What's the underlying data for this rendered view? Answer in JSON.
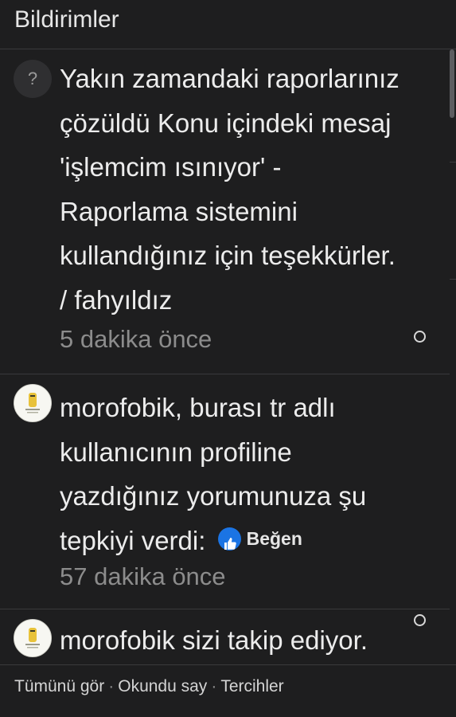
{
  "header": {
    "title": "Bildirimler"
  },
  "notifications": [
    {
      "avatar": "question-avatar",
      "avatar_glyph": "?",
      "message": "Yakın zamandaki raporlarınız çözüldü Konu içindeki mesaj 'işlemcim ısınıyor' - Raporlama sistemini kullandığınız için teşekkürler. / fahyıldız",
      "time": "5 dakika önce",
      "read_marker": "unread"
    },
    {
      "avatar": "user-avatar",
      "message": "morofobik, burası tr adlı kullanıcının profiline yazdığınız yorumunuza şu tepkiyi verdi:",
      "reaction": {
        "icon": "like-thumb-icon",
        "label": "Beğen",
        "color": "#1b74e4"
      },
      "time": "57 dakika önce",
      "read_marker": "unread"
    },
    {
      "avatar": "user-avatar",
      "message": "morofobik sizi takip ediyor."
    }
  ],
  "footer": {
    "links": [
      "Tümünü gör",
      "Okundu say",
      "Tercihler"
    ],
    "separator": "·"
  },
  "colors": {
    "background": "#1e1e1f",
    "divider": "#3a3a3c",
    "text": "#ececec",
    "muted": "#8c8c8c",
    "like_blue": "#1b74e4"
  }
}
